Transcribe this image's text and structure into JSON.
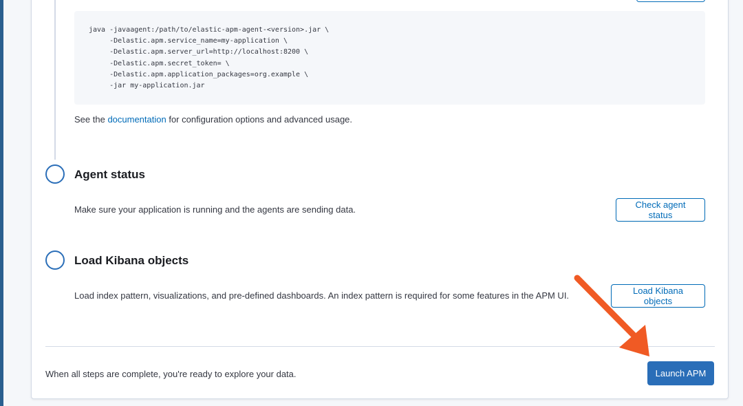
{
  "code": {
    "lines": [
      "java -javaagent:/path/to/elastic-apm-agent-<version>.jar \\",
      "     -Delastic.apm.service_name=my-application \\",
      "     -Delastic.apm.server_url=http://localhost:8200 \\",
      "     -Delastic.apm.secret_token= \\",
      "     -Delastic.apm.application_packages=org.example \\",
      "     -jar my-application.jar"
    ]
  },
  "doc_note": {
    "prefix": "See the ",
    "link": "documentation",
    "suffix": " for configuration options and advanced usage."
  },
  "steps": [
    {
      "title": "Agent status",
      "description": "Make sure your application is running and the agents are sending data.",
      "button": "Check agent status"
    },
    {
      "title": "Load Kibana objects",
      "description": "Load index pattern, visualizations, and pre-defined dashboards. An index pattern is required for some features in the APM UI.",
      "button": "Load Kibana objects"
    }
  ],
  "footer": {
    "text": "When all steps are complete, you're ready to explore your data.",
    "launch_button": "Launch APM"
  },
  "colors": {
    "accent": "#006bb8",
    "primary_button": "#2a6eb8",
    "annotation_arrow": "#f05a24"
  },
  "icons": {
    "annotation": "arrow-pointer-icon"
  }
}
